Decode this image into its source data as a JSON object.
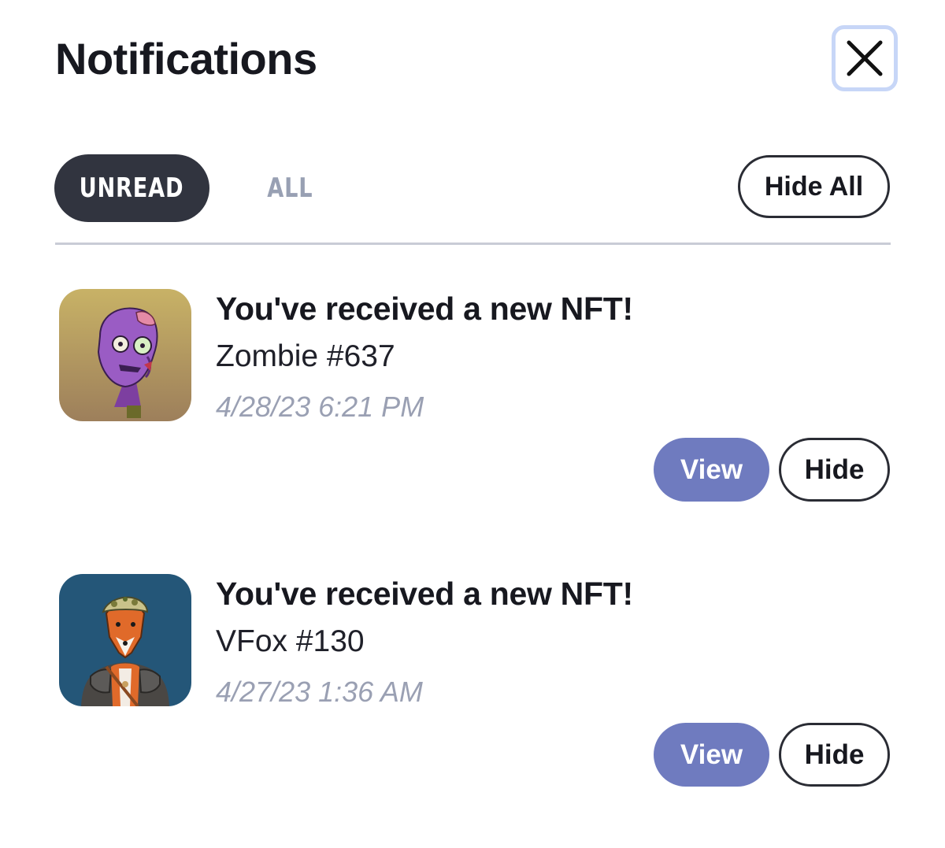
{
  "header": {
    "title": "Notifications",
    "close_icon": "close-icon"
  },
  "tabs": [
    {
      "label": "UNREAD",
      "active": true
    },
    {
      "label": "ALL",
      "active": false
    }
  ],
  "hide_all_label": "Hide All",
  "notifications": [
    {
      "title": "You've received a new NFT!",
      "item_name": "Zombie #637",
      "timestamp": "4/28/23 6:21 PM",
      "thumbnail_icon": "zombie-nft-thumbnail",
      "view_label": "View",
      "hide_label": "Hide"
    },
    {
      "title": "You've received a new NFT!",
      "item_name": "VFox #130",
      "timestamp": "4/27/23 1:36 AM",
      "thumbnail_icon": "fox-nft-thumbnail",
      "view_label": "View",
      "hide_label": "Hide"
    }
  ],
  "colors": {
    "active_tab_bg": "#31343f",
    "inactive_tab_text": "#98a0b3",
    "view_button_bg": "#6f7bbf",
    "close_button_border": "#c7d6f7",
    "timestamp_text": "#9aa0b3"
  }
}
